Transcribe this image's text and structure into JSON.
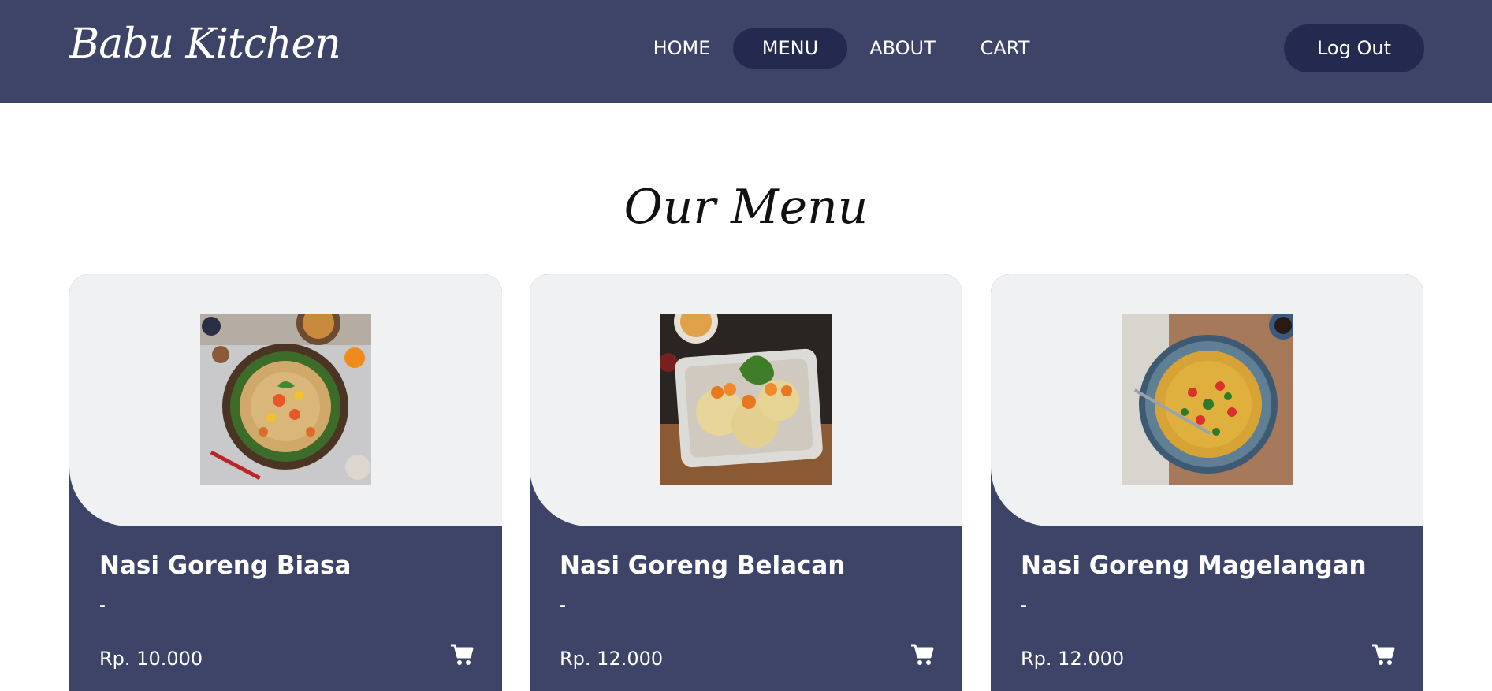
{
  "brand": "Babu Kitchen",
  "nav": {
    "home": "HOME",
    "menu": "MENU",
    "about": "ABOUT",
    "cart": "CART",
    "logout": "Log Out"
  },
  "section_title": "Our Menu",
  "menu_items": [
    {
      "name": "Nasi Goreng Biasa",
      "description": "-",
      "price": "Rp. 10.000"
    },
    {
      "name": "Nasi Goreng Belacan",
      "description": "-",
      "price": "Rp. 12.000"
    },
    {
      "name": "Nasi Goreng Magelangan",
      "description": "-",
      "price": "Rp. 12.000"
    }
  ],
  "icons": {
    "cart": "cart-icon"
  },
  "colors": {
    "navbar": "#3e4468",
    "accent_dark": "#242a4f",
    "card_top": "#f0f1f3"
  }
}
